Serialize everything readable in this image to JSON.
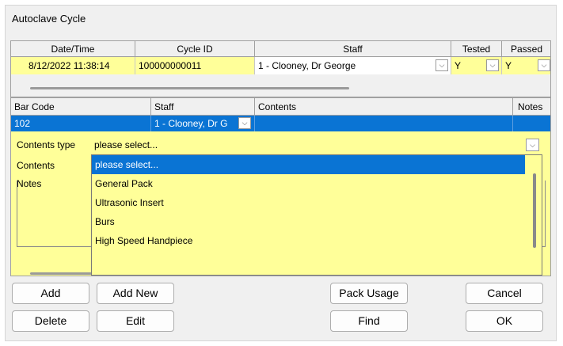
{
  "window": {
    "title": "Autoclave Cycle"
  },
  "cycle_grid": {
    "headers": [
      "Date/Time",
      "Cycle ID",
      "Staff",
      "Tested",
      "Passed"
    ],
    "row": {
      "datetime": "8/12/2022 11:38:14",
      "cycle_id": "100000000011",
      "staff": "1 - Clooney, Dr George",
      "tested": "Y",
      "passed": "Y"
    }
  },
  "items_grid": {
    "headers": [
      "Bar Code",
      "Staff",
      "Contents",
      "Notes"
    ],
    "selected_row": {
      "barcode": "102",
      "staff": "1 - Clooney, Dr G",
      "contents": "",
      "notes": ""
    },
    "detail": {
      "contents_type_label": "Contents type",
      "contents_type_value": "please select...",
      "contents_label": "Contents",
      "notes_label": "Notes"
    }
  },
  "dropdown": {
    "options": [
      "please select...",
      "General Pack",
      "Ultrasonic Insert",
      "Burs",
      "High Speed Handpiece"
    ],
    "selected": "please select..."
  },
  "buttons": {
    "add": "Add",
    "add_new": "Add New",
    "pack_usage": "Pack Usage",
    "cancel": "Cancel",
    "delete": "Delete",
    "edit": "Edit",
    "find": "Find",
    "ok": "OK"
  },
  "colors": {
    "highlight_blue": "#0a74d4",
    "row_yellow": "#ffff99",
    "window_bg": "#f0f0f0"
  }
}
